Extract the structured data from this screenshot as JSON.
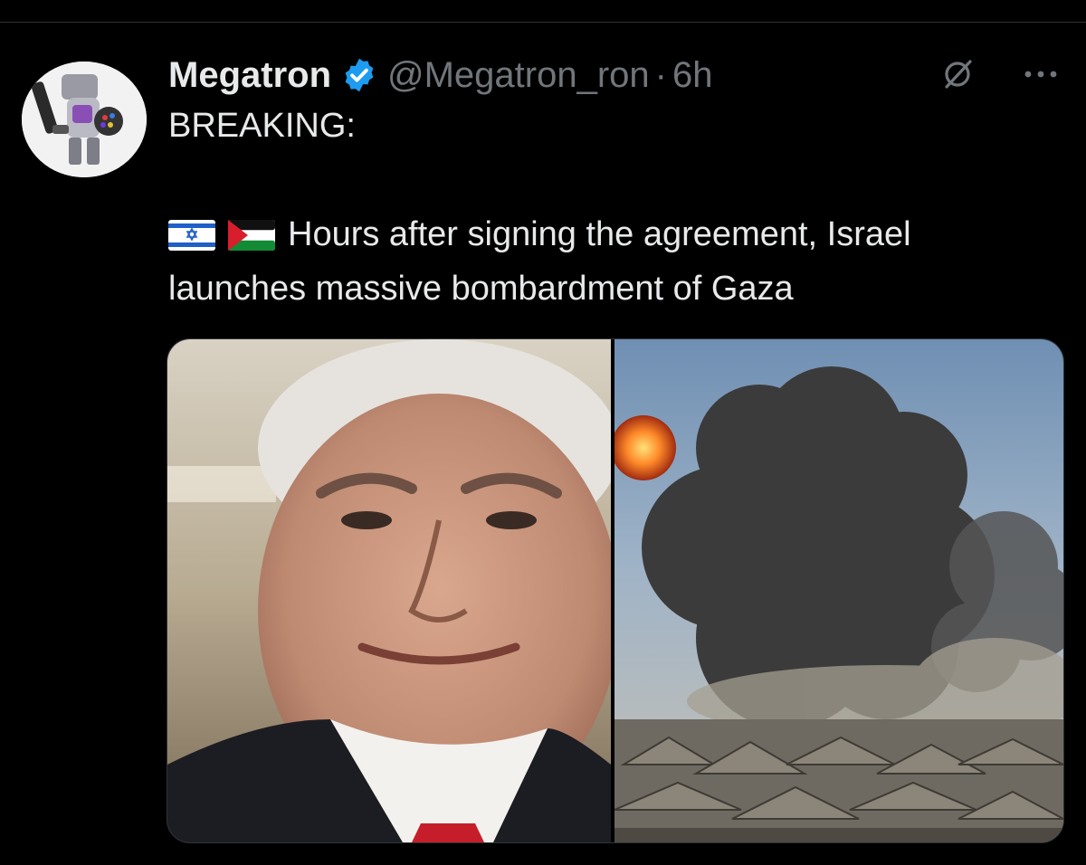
{
  "post": {
    "author_name": "Megatron",
    "handle": "@Megatron_ron",
    "separator": "·",
    "time": "6h",
    "text_line1": "BREAKING:",
    "text_line2": "Hours after signing the agreement, Israel",
    "text_line3": "launches massive bombardment of Gaza",
    "flags": [
      "israel-flag-icon",
      "palestine-flag-icon"
    ],
    "verified_color": "#1d9bf0"
  },
  "icons": {
    "verified": "verified-badge-icon",
    "grok": "grok-icon",
    "more": "more-options-icon"
  },
  "colors": {
    "background": "#000000",
    "text_primary": "#e7e9ea",
    "text_secondary": "#71767b"
  }
}
